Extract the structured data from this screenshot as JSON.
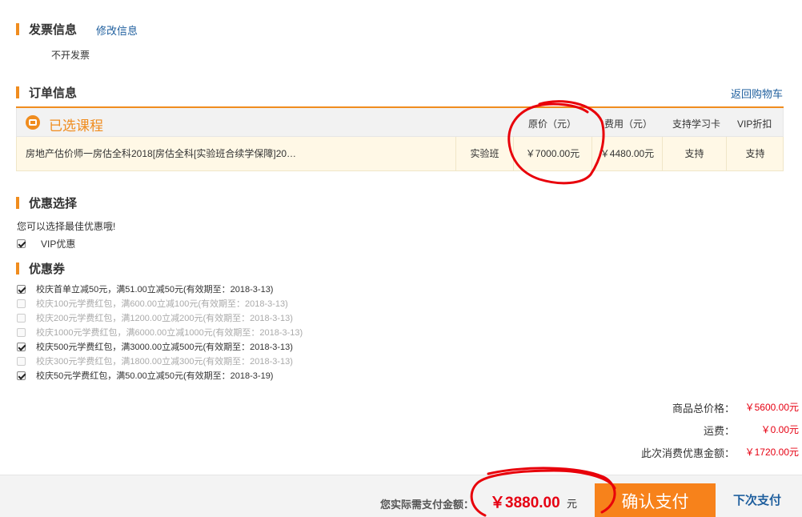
{
  "invoice": {
    "title": "发票信息",
    "edit_link": "修改信息",
    "value": "不开发票"
  },
  "order": {
    "title": "订单信息",
    "back_link": "返回购物车",
    "selected_label": "已选课程",
    "headers": {
      "original_price": "原价（元）",
      "fee": "费用（元）",
      "study_card": "支持学习卡",
      "vip_discount": "VIP折扣"
    },
    "row": {
      "name": "房地产估价师一房估全科2018[房估全科[实验班合续学保障]20…",
      "class_type": "实验班",
      "original_price": "￥7000.00元",
      "fee": "￥4480.00元",
      "study_card": "支持",
      "vip_discount": "支持"
    }
  },
  "discount": {
    "title": "优惠选择",
    "hint": "您可以选择最佳优惠哦!",
    "vip": {
      "label": "VIP优惠",
      "checked": true
    }
  },
  "coupons": {
    "title": "优惠券",
    "items": [
      {
        "label": "校庆首单立减50元，满51.00立减50元(有效期至：2018-3-13)",
        "checked": true,
        "enabled": true
      },
      {
        "label": "校庆100元学费红包，满600.00立减100元(有效期至：2018-3-13)",
        "checked": false,
        "enabled": false
      },
      {
        "label": "校庆200元学费红包，满1200.00立减200元(有效期至：2018-3-13)",
        "checked": false,
        "enabled": false
      },
      {
        "label": "校庆1000元学费红包，满6000.00立减1000元(有效期至：2018-3-13)",
        "checked": false,
        "enabled": false
      },
      {
        "label": "校庆500元学费红包，满3000.00立减500元(有效期至：2018-3-13)",
        "checked": true,
        "enabled": true
      },
      {
        "label": "校庆300元学费红包，满1800.00立减300元(有效期至：2018-3-13)",
        "checked": false,
        "enabled": false
      },
      {
        "label": "校庆50元学费红包，满50.00立减50元(有效期至：2018-3-19)",
        "checked": true,
        "enabled": true
      }
    ]
  },
  "summary": {
    "total_label": "商品总价格：",
    "total_value": "￥5600.00元",
    "shipping_label": "运费：",
    "shipping_value": "￥0.00元",
    "discount_label": "此次消费优惠金额：",
    "discount_value": "￥1720.00元"
  },
  "payment": {
    "label": "您实际需支付金额：",
    "amount": "￥3880.00",
    "unit": "元",
    "confirm_button": "确认支付",
    "later_link": "下次支付"
  },
  "colors": {
    "accent": "#f08c1e",
    "price_red": "#e60012",
    "link_blue": "#1f5f9e",
    "annotation_red": "#e8000a"
  }
}
